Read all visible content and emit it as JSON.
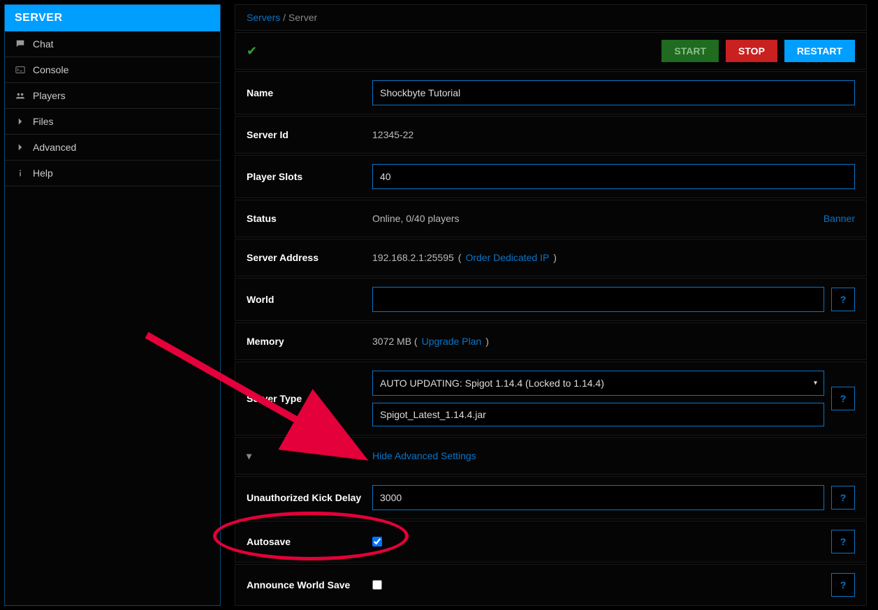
{
  "sidebar": {
    "title": "SERVER",
    "items": [
      {
        "label": "Chat",
        "icon": "chat-icon"
      },
      {
        "label": "Console",
        "icon": "console-icon"
      },
      {
        "label": "Players",
        "icon": "players-icon"
      },
      {
        "label": "Files",
        "icon": "chevron-right-icon"
      },
      {
        "label": "Advanced",
        "icon": "chevron-right-icon"
      },
      {
        "label": "Help",
        "icon": "info-icon"
      }
    ]
  },
  "breadcrumb": {
    "root": "Servers",
    "sep": "/",
    "current": "Server"
  },
  "controls": {
    "start": "START",
    "stop": "STOP",
    "restart": "RESTART"
  },
  "fields": {
    "name": {
      "label": "Name",
      "value": "Shockbyte Tutorial"
    },
    "server_id": {
      "label": "Server Id",
      "value": "12345-22"
    },
    "player_slots": {
      "label": "Player Slots",
      "value": "40"
    },
    "status": {
      "label": "Status",
      "value": "Online, 0/40 players",
      "banner_link": "Banner"
    },
    "server_address": {
      "label": "Server Address",
      "value": "192.168.2.1:25595",
      "link": "Order Dedicated IP"
    },
    "world": {
      "label": "World",
      "value": ""
    },
    "memory": {
      "label": "Memory",
      "value_prefix": "3072 MB (",
      "link": "Upgrade Plan",
      "value_suffix": ")"
    },
    "server_type": {
      "label": "Server Type",
      "select_value": "AUTO UPDATING: Spigot 1.14.4 (Locked to 1.14.4)",
      "jar_value": "Spigot_Latest_1.14.4.jar"
    },
    "advanced_toggle": {
      "label": "Hide Advanced Settings"
    },
    "unauth_kick": {
      "label": "Unauthorized Kick Delay",
      "value": "3000"
    },
    "autosave": {
      "label": "Autosave",
      "checked": true
    },
    "announce_world_save": {
      "label": "Announce World Save",
      "checked": false
    }
  },
  "help_symbol": "?"
}
